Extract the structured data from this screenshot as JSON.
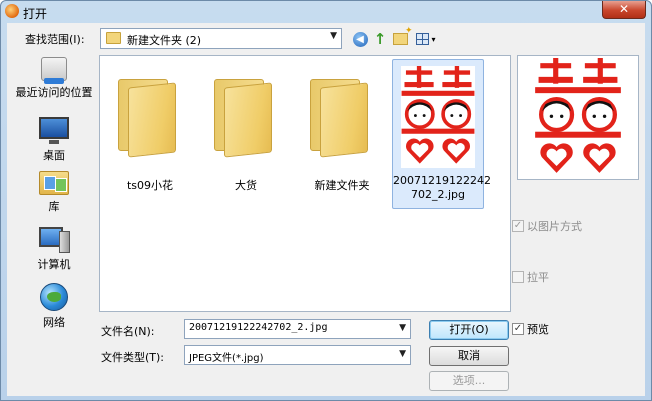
{
  "window": {
    "title": "打开",
    "close_glyph": "✕"
  },
  "lookin": {
    "label": "查找范围(I):",
    "value": "新建文件夹 (2)"
  },
  "toolbar": {
    "back_glyph": "◀",
    "up_glyph": "↑",
    "view_dropdown_glyph": "▾"
  },
  "places": [
    {
      "label": "最近访问的位置",
      "icon": "recent-places-icon"
    },
    {
      "label": "桌面",
      "icon": "desktop-icon"
    },
    {
      "label": "库",
      "icon": "libraries-icon"
    },
    {
      "label": "计算机",
      "icon": "computer-icon"
    },
    {
      "label": "网络",
      "icon": "network-icon"
    }
  ],
  "files": [
    {
      "label": "ts09小花",
      "type": "folder"
    },
    {
      "label": "大货",
      "type": "folder"
    },
    {
      "label": "新建文件夹",
      "type": "folder"
    },
    {
      "label_line1": "20071219122242",
      "label_line2": "702_2.jpg",
      "type": "image",
      "selected": true
    }
  ],
  "options": {
    "as_picture": {
      "label": "以图片方式",
      "checked": true,
      "enabled": false
    },
    "tile": {
      "label": "拉平",
      "checked": false,
      "enabled": false
    },
    "preview": {
      "label": "预览",
      "checked": true,
      "enabled": true
    }
  },
  "filename": {
    "label": "文件名(N):",
    "value": "20071219122242702_2.jpg"
  },
  "filetype": {
    "label": "文件类型(T):",
    "value": "JPEG文件(*.jpg)"
  },
  "buttons": {
    "open": "打开(O)",
    "cancel": "取消",
    "options": "选项..."
  },
  "colors": {
    "accent_red": "#e2231a",
    "face_black": "#111111",
    "selection": "#dbeafc"
  }
}
